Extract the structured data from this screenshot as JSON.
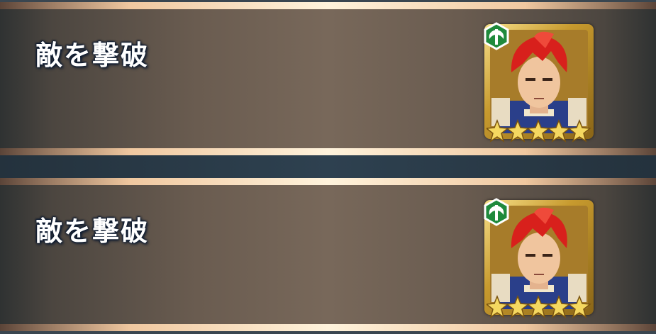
{
  "banners": [
    {
      "title": "敵を撃破",
      "rarity": 5,
      "weapon_icon": "axe-icon"
    },
    {
      "title": "敵を撃破",
      "rarity": 5,
      "weapon_icon": "axe-icon"
    }
  ],
  "colors": {
    "weapon_badge": "#1f8a3c",
    "hair": "#d8201c",
    "frame": "#e2b84c",
    "star": "#f5d860"
  }
}
